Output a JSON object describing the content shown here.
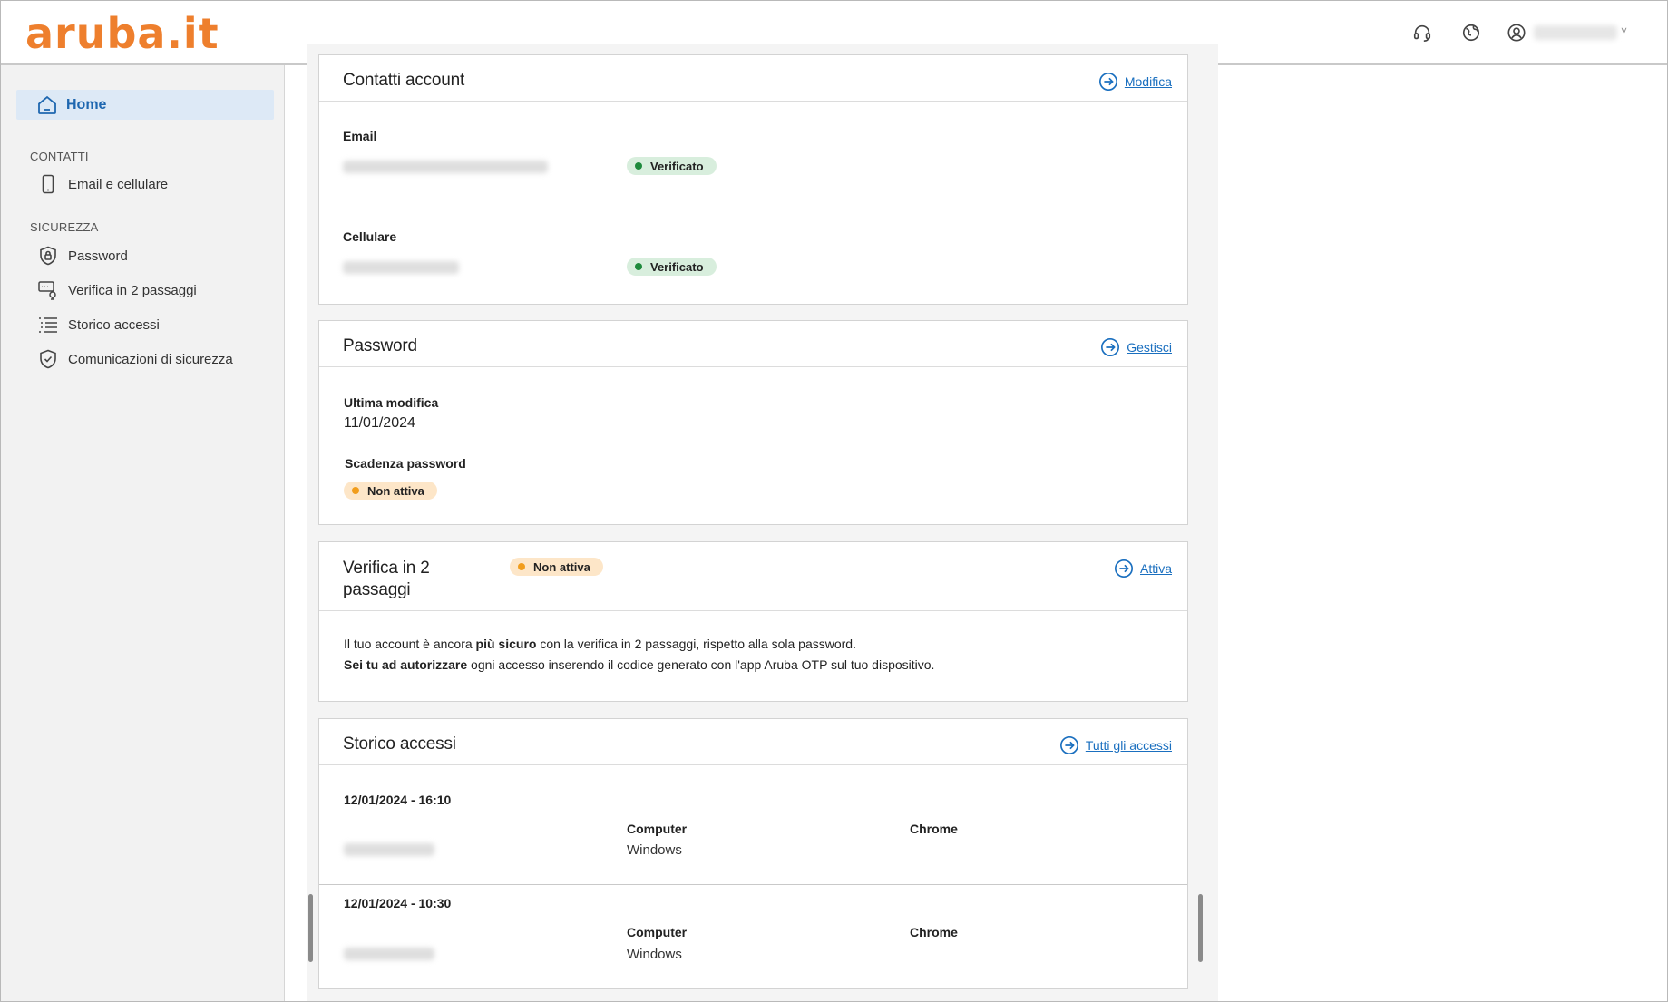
{
  "header": {
    "logo": "aruba.it",
    "icons": [
      "headset-icon",
      "globe-icon",
      "user-icon"
    ],
    "user_caret": "˅"
  },
  "sidebar": {
    "home": "Home",
    "section_contatti": "CONTATTI",
    "email_cellulare": "Email e cellulare",
    "section_sicurezza": "SICUREZZA",
    "password": "Password",
    "verifica": "Verifica in 2 passaggi",
    "storico": "Storico accessi",
    "comunicazioni": "Comunicazioni di sicurezza"
  },
  "contatti": {
    "title": "Contatti account",
    "link": "Modifica",
    "email_label": "Email",
    "email_status": "Verificato",
    "cell_label": "Cellulare",
    "cell_status": "Verificato"
  },
  "password": {
    "title": "Password",
    "link": "Gestisci",
    "last_label": "Ultima modifica",
    "last_value": "11/01/2024",
    "exp_label": "Scadenza password",
    "exp_status": "Non attiva"
  },
  "twofa": {
    "title_line1": "Verifica in 2",
    "title_line2": "passaggi",
    "status": "Non attiva",
    "link": "Attiva",
    "p1_a": "Il tuo account è ancora ",
    "p1_b": "più sicuro",
    "p1_c": " con la verifica in 2 passaggi, rispetto alla sola password.",
    "p2_a": "Sei tu ad autorizzare",
    "p2_b": " ogni accesso inserendo il codice generato con l'app Aruba OTP sul tuo dispositivo."
  },
  "storico": {
    "title": "Storico accessi",
    "link": "Tutti gli accessi",
    "rows": [
      {
        "datetime": "12/01/2024 - 16:10",
        "device": "Computer",
        "os": "Windows",
        "browser": "Chrome"
      },
      {
        "datetime": "12/01/2024 - 10:30",
        "device": "Computer",
        "os": "Windows",
        "browser": "Chrome"
      }
    ]
  },
  "colors": {
    "brand": "#ee7f2d",
    "link": "#1a6fbf",
    "verified": "#1e8a3c",
    "inactive": "#f19d1c"
  }
}
